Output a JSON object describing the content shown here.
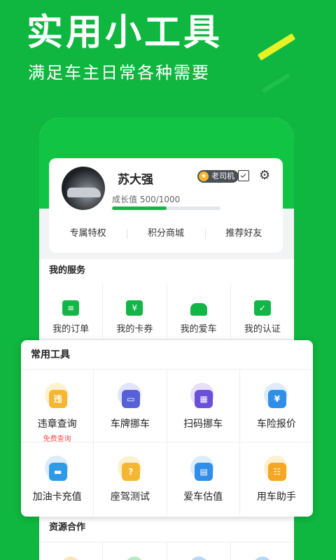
{
  "banner": {
    "title": "实用小工具",
    "subtitle": "满足车主日常各种需要"
  },
  "profile": {
    "name": "苏大强",
    "badge": "老司机",
    "badge_icon": "star-icon",
    "growth_label": "成长值 500/1000",
    "growth_current": 500,
    "growth_max": 1000,
    "quick_links": [
      "专属特权",
      "积分商城",
      "推荐好友"
    ]
  },
  "my_services": {
    "title": "我的服务",
    "items": [
      {
        "label": "我的订单",
        "icon": "order-icon"
      },
      {
        "label": "我的卡券",
        "icon": "coupon-icon",
        "glyph": "¥"
      },
      {
        "label": "我的爱车",
        "icon": "car-icon"
      },
      {
        "label": "我的认证",
        "icon": "certificate-icon"
      }
    ]
  },
  "common_tools": {
    "title": "常用工具",
    "items": [
      {
        "label": "违章查询",
        "sub": "免费查询",
        "icon": "violation-icon",
        "glyph": "违",
        "color": "#f5b731",
        "halo": "#fdf1cf"
      },
      {
        "label": "车牌挪车",
        "icon": "license-plate-icon",
        "color": "#5661d9",
        "halo": "#e1e4fb"
      },
      {
        "label": "扫码挪车",
        "icon": "qr-code-icon",
        "color": "#6a4fd8",
        "halo": "#e6e0fb"
      },
      {
        "label": "车险报价",
        "icon": "insurance-shield-icon",
        "glyph": "¥",
        "color": "#2f8ee8",
        "halo": "#dcecfb"
      },
      {
        "label": "加油卡充值",
        "icon": "fuel-card-icon",
        "color": "#2f9be8",
        "halo": "#dcecfb"
      },
      {
        "label": "座驾测试",
        "icon": "car-test-icon",
        "glyph": "?",
        "color": "#f5b731",
        "halo": "#fdf1cf"
      },
      {
        "label": "爱车估值",
        "icon": "calculator-icon",
        "color": "#2f8ee8",
        "halo": "#dcecfb"
      },
      {
        "label": "用车助手",
        "icon": "assistant-book-icon",
        "color": "#f5a623",
        "halo": "#fdf1cf"
      }
    ]
  },
  "resources": {
    "title": "资源合作"
  },
  "colors": {
    "brand_green": "#0fb63f",
    "accent_yellow": "#e4f226"
  }
}
